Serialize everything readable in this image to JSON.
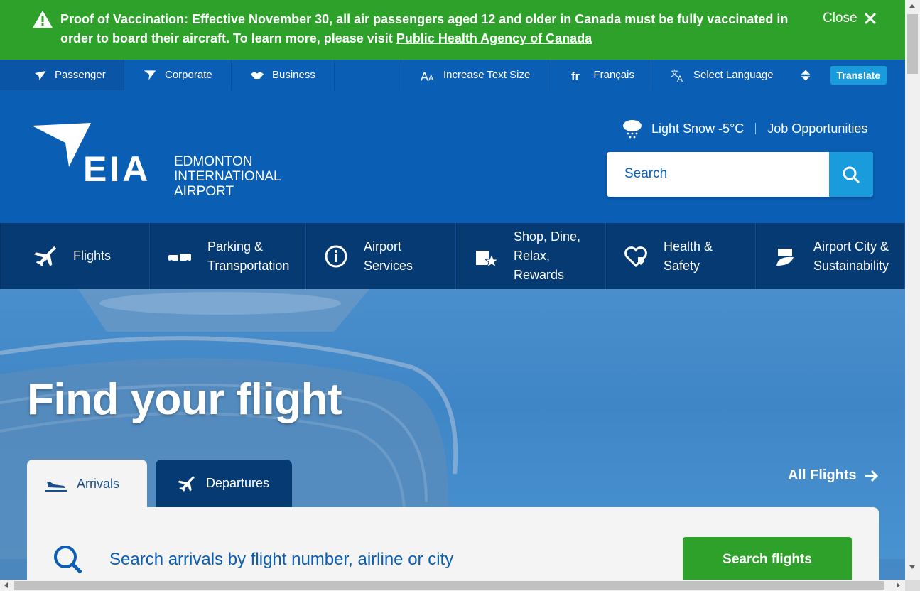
{
  "alert": {
    "text": "Proof of Vaccination: Effective November 30, all air passengers aged 12 and older in Canada must be fully vaccinated in order to board their aircraft. To learn more, please visit ",
    "link_text": "Public Health Agency of Canada",
    "close_label": "Close"
  },
  "utility": {
    "audience": [
      {
        "label": "Passenger",
        "icon": "plane-icon"
      },
      {
        "label": "Corporate",
        "icon": "paper-plane-icon"
      },
      {
        "label": "Business",
        "icon": "handshake-icon"
      }
    ],
    "text_size_label": "Increase Text Size",
    "francais_label": "Français",
    "language_label": "Select Language",
    "translate_label": "Translate"
  },
  "header": {
    "logo_letters": "EIA",
    "logo_line1": "EDMONTON",
    "logo_line2": "INTERNATIONAL",
    "logo_line3": "AIRPORT",
    "weather": "Light Snow -5°C",
    "jobs_label": "Job Opportunities",
    "search_placeholder": "Search"
  },
  "nav": [
    {
      "label": "Flights",
      "icon": "plane-icon"
    },
    {
      "label": "Parking & Transportation",
      "icon": "cars-icon"
    },
    {
      "label": "Airport Services",
      "icon": "info-icon"
    },
    {
      "label": "Shop, Dine, Relax, Rewards",
      "icon": "shopping-bag-star-icon"
    },
    {
      "label": "Health & Safety",
      "icon": "heart-shield-icon"
    },
    {
      "label": "Airport City & Sustainability",
      "icon": "leaf-building-icon"
    }
  ],
  "hero": {
    "title": "Find your flight",
    "tab_arrivals": "Arrivals",
    "tab_departures": "Departures",
    "all_flights": "All Flights",
    "search_placeholder": "Search arrivals by flight number, airline or city",
    "search_button": "Search flights"
  },
  "colors": {
    "alert_green": "#2da12a",
    "brand_blue": "#0a5fb5",
    "nav_navy": "#063a73",
    "accent_cyan": "#1a9bdc"
  }
}
